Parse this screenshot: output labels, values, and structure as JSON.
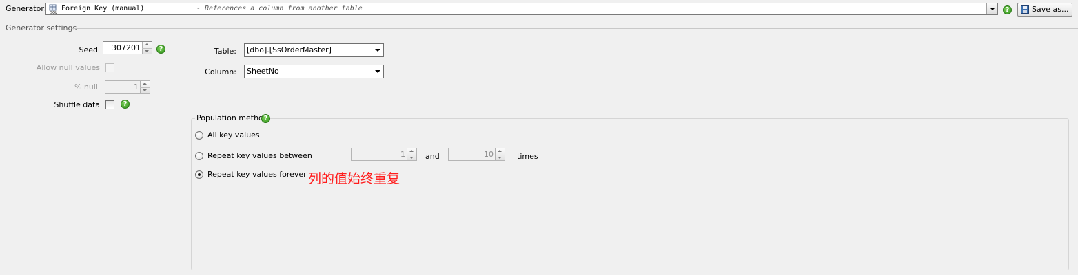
{
  "header": {
    "generator_label": "Generator:",
    "generator_name": "Foreign Key (manual)",
    "generator_description": "- References a column from another table",
    "help_glyph": "?",
    "save_button_label": "Save as..."
  },
  "settings": {
    "section_title": "Generator settings",
    "seed_label": "Seed",
    "seed_value": "307201",
    "allow_null_label": "Allow null values",
    "allow_null_checked": false,
    "percent_null_label": "% null",
    "percent_null_value": "1",
    "shuffle_label": "Shuffle data",
    "shuffle_checked": false,
    "table_label": "Table:",
    "table_value": "[dbo].[SsOrderMaster]",
    "column_label": "Column:",
    "column_value": "SheetNo"
  },
  "population": {
    "title": "Population method",
    "options": [
      {
        "label": "All key values",
        "selected": false
      },
      {
        "label": "Repeat key values between",
        "selected": false
      },
      {
        "label": "Repeat key values forever",
        "selected": true
      }
    ],
    "repeat_min": "1",
    "and_label": "and",
    "repeat_max": "10",
    "times_label": "times",
    "annotation": "列的值始终重复"
  },
  "colors": {
    "annotation_red": "#ff1e1e",
    "help_green": "#2e8f1a"
  }
}
